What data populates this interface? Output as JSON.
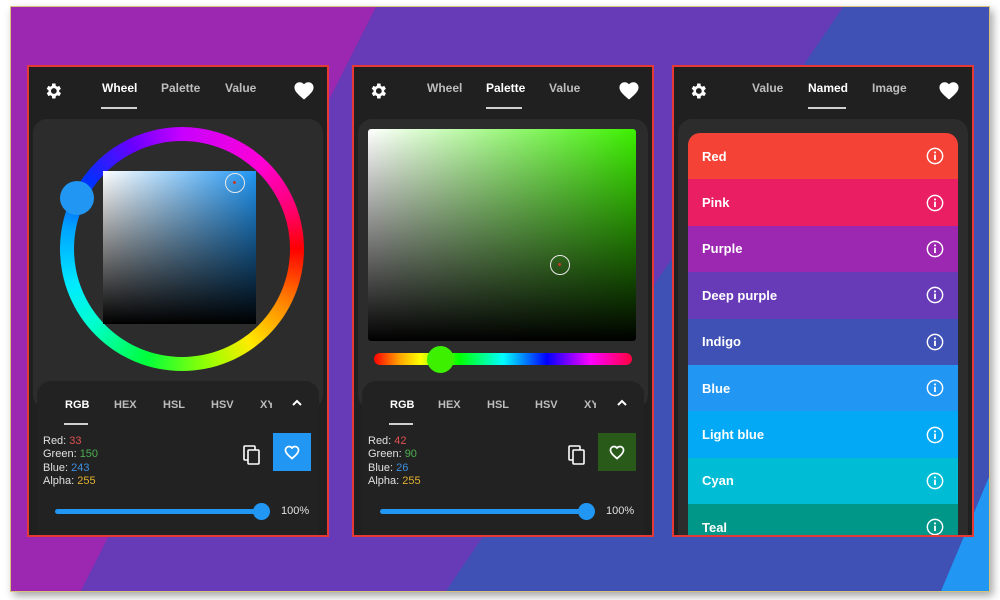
{
  "screens": [
    {
      "tabs": [
        {
          "label": "Wheel",
          "active": true
        },
        {
          "label": "Palette",
          "active": false
        },
        {
          "label": "Value",
          "active": false
        }
      ],
      "format_tabs": [
        "RGB",
        "HEX",
        "HSL",
        "HSV",
        "XY"
      ],
      "active_format": "RGB",
      "values": {
        "red_label": "Red: ",
        "red": "33",
        "green_label": "Green: ",
        "green": "150",
        "blue_label": "Blue: ",
        "blue": "243",
        "alpha_label": "Alpha: ",
        "alpha": "255"
      },
      "favorite_color": "#2196f3",
      "alpha_percent": "100%",
      "alpha_fraction": 1.0
    },
    {
      "tabs": [
        {
          "label": "Wheel",
          "active": false
        },
        {
          "label": "Palette",
          "active": true
        },
        {
          "label": "Value",
          "active": false
        }
      ],
      "format_tabs": [
        "RGB",
        "HEX",
        "HSL",
        "HSV",
        "XY"
      ],
      "active_format": "RGB",
      "values": {
        "red_label": "Red: ",
        "red": "42",
        "green_label": "Green: ",
        "green": "90",
        "blue_label": "Blue: ",
        "blue": "26",
        "alpha_label": "Alpha: ",
        "alpha": "255"
      },
      "favorite_color": "#2a5a1a",
      "alpha_percent": "100%",
      "alpha_fraction": 1.0
    },
    {
      "tabs": [
        {
          "label": "Value",
          "active": false
        },
        {
          "label": "Named",
          "active": true
        },
        {
          "label": "Image",
          "active": false
        }
      ],
      "named_colors": [
        {
          "label": "Red",
          "color": "#f44336"
        },
        {
          "label": "Pink",
          "color": "#e91e63"
        },
        {
          "label": "Purple",
          "color": "#9c27b0"
        },
        {
          "label": "Deep purple",
          "color": "#673ab7"
        },
        {
          "label": "Indigo",
          "color": "#3f51b5"
        },
        {
          "label": "Blue",
          "color": "#2196f3"
        },
        {
          "label": "Light blue",
          "color": "#03a9f4"
        },
        {
          "label": "Cyan",
          "color": "#00bcd4"
        },
        {
          "label": "Teal",
          "color": "#009688"
        }
      ]
    }
  ],
  "value_colors": {
    "red": "#e05050",
    "green": "#4caf50",
    "blue": "#3d8fe0",
    "alpha": "#e0b030"
  }
}
